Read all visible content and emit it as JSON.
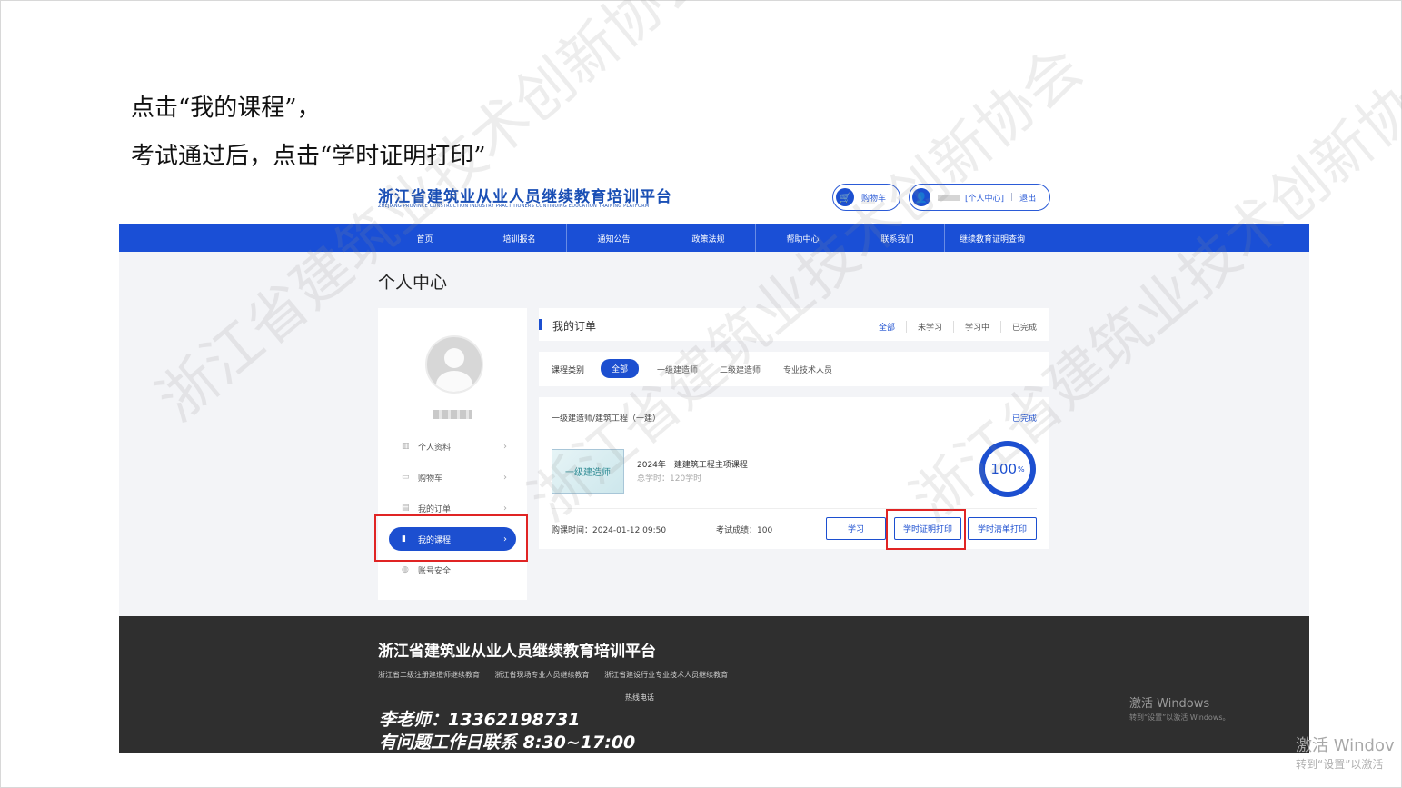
{
  "instructions": {
    "line1": "点击“我的课程”，",
    "line2": "考试通过后，点击“学时证明打印”"
  },
  "header": {
    "logo_cn": "浙江省建筑业从业人员继续教育培训平台",
    "logo_en": "ZHEJIANG PROVINCE CONSTRUCTION INDUSTRY PRACTITIONERS CONTINUING EDUCATION TRAINING PLATFORM",
    "cart_label": "购物车",
    "user_center": "[个人中心]",
    "logout": "退出"
  },
  "nav": [
    "首页",
    "培训报名",
    "通知公告",
    "政策法规",
    "帮助中心",
    "联系我们",
    "继续教育证明查询"
  ],
  "page_title": "个人中心",
  "sidebar": {
    "items": [
      {
        "label": "个人资料"
      },
      {
        "label": "购物车"
      },
      {
        "label": "我的订单"
      },
      {
        "label": "我的课程"
      },
      {
        "label": "账号安全"
      }
    ]
  },
  "orders": {
    "title": "我的订单",
    "tabs": [
      "全部",
      "未学习",
      "学习中",
      "已完成"
    ]
  },
  "category": {
    "label": "课程类别",
    "options": [
      "全部",
      "一级建造师",
      "二级建造师",
      "专业技术人员"
    ]
  },
  "course": {
    "category_title": "一级建造师/建筑工程（一建）",
    "status": "已完成",
    "thumb_text": "一级建造师",
    "name": "2024年一建建筑工程主项课程",
    "hours": "总学时：120学时",
    "progress": "100",
    "progress_unit": "%",
    "purchase_time": "购课时间：2024-01-12 09:50",
    "score": "考试成绩：100",
    "buttons": {
      "study": "学习",
      "cert": "学时证明打印",
      "list": "学时清单打印"
    }
  },
  "footer": {
    "title": "浙江省建筑业从业人员继续教育培训平台",
    "links": [
      "浙江省二级注册建造师继续教育",
      "浙江省现场专业人员继续教育",
      "浙江省建设行业专业技术人员继续教育"
    ],
    "hotline": "热线电话",
    "phone": "李老师：13362198731",
    "hours": "有问题工作日联系 8:30~17:00"
  },
  "windows_activation": {
    "title": "激活 Windows",
    "subtitle": "转到“设置”以激活 Windows。",
    "title_cut": "激活 Windov",
    "subtitle_cut": "转到“设置”以激活"
  },
  "watermark": "浙江省建筑业技术创新协会"
}
